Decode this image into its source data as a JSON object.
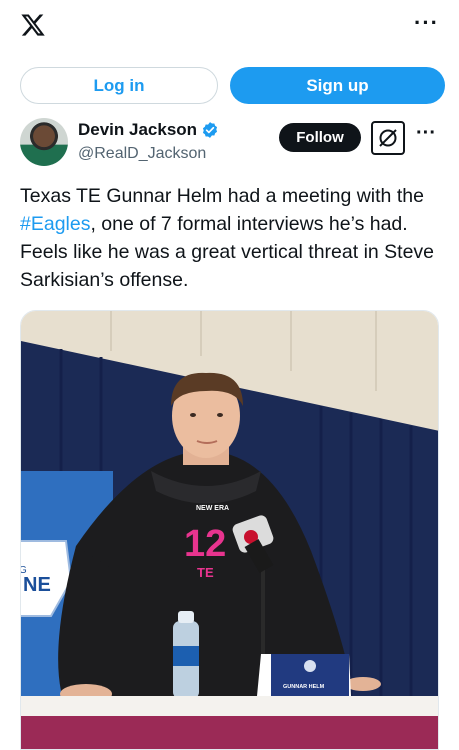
{
  "topbar": {
    "logo_icon": "x-logo-icon",
    "more_icon": "more-horizontal-icon",
    "more_label": "···"
  },
  "auth": {
    "login_label": "Log in",
    "signup_label": "Sign up"
  },
  "post": {
    "author_name": "Devin Jackson",
    "author_handle": "@RealD_Jackson",
    "follow_label": "Follow",
    "more_label": "···",
    "text_before": "Texas TE Gunnar Helm had a meeting with the ",
    "hashtag": "#Eagles",
    "text_after": ", one of 7 formal interviews he’s had. Feels like he was a great vertical threat in Steve Sarkisian’s offense."
  },
  "media": {
    "jersey_number": "12",
    "jersey_position": "TE",
    "shirt_logo_text": "NEW ERA",
    "nameplate": "GUNNAR HELM",
    "backdrop_text": "NE",
    "backdrop_text_small": "G"
  },
  "colors": {
    "accent": "#1d9bf0",
    "text": "#0f1419",
    "muted": "#536471",
    "jersey_number": "#e8348f"
  }
}
